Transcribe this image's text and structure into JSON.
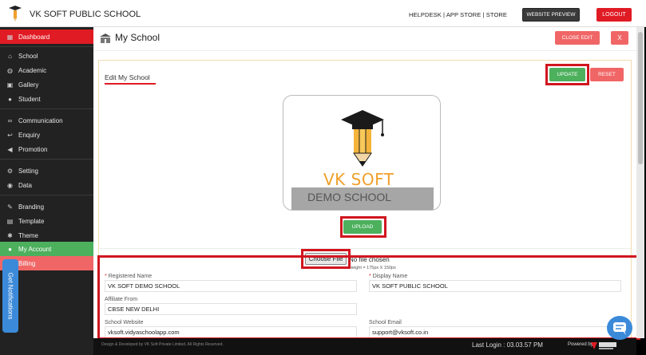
{
  "header": {
    "app_title": "VK SOFT PUBLIC SCHOOL",
    "links": "HELPDESK | APP STORE | STORE",
    "preview_label": "WEBSITE PREVIEW",
    "logout_label": "LOGOUT"
  },
  "sidebar": {
    "items": [
      {
        "label": "Dashboard",
        "icon": "dashboard-icon",
        "state": "active"
      },
      {
        "label": "School",
        "icon": "school-icon"
      },
      {
        "label": "Academic",
        "icon": "globe-icon"
      },
      {
        "label": "Gallery",
        "icon": "image-icon"
      },
      {
        "label": "Student",
        "icon": "user-icon"
      },
      {
        "label": "Communication",
        "icon": "link-icon"
      },
      {
        "label": "Enquiry",
        "icon": "reply-icon"
      },
      {
        "label": "Promotion",
        "icon": "megaphone-icon"
      },
      {
        "label": "Setting",
        "icon": "gear-icon"
      },
      {
        "label": "Data",
        "icon": "database-icon"
      },
      {
        "label": "Branding",
        "icon": "pencil-icon"
      },
      {
        "label": "Template",
        "icon": "template-icon"
      },
      {
        "label": "Theme",
        "icon": "bug-icon"
      },
      {
        "label": "My Account",
        "icon": "user-icon",
        "state": "success"
      },
      {
        "label": "Billing",
        "icon": "billing-icon",
        "state": "danger"
      }
    ],
    "notifications_tab": "Get Notifications"
  },
  "page": {
    "title": "My School",
    "close_edit_label": "CLOSE EDIT",
    "close_label": "X"
  },
  "card": {
    "title": "Edit My School",
    "update_label": "UPDATE",
    "reset_label": "RESET",
    "logo_text": "VK SOFT",
    "logo_caption": "DEMO SCHOOL",
    "upload_label": "UPLOAD",
    "choose_file_label": "Choose File",
    "file_status": "No file chosen",
    "size_hint": "Height = 175px X 150px"
  },
  "form": {
    "registered_name_label": "Registered Name",
    "registered_name_value": "VK SOFT DEMO SCHOOL",
    "display_name_label": "Display Name",
    "display_name_value": "VK SOFT PUBLIC SCHOOL",
    "affiliate_label": "Affiliate From",
    "affiliate_value": "CBSE NEW DELHI",
    "website_label": "School Website",
    "website_value": "vksoft.vidyaschoolapp.com",
    "email_label": "School Email",
    "email_value": "support@vksoft.co.in",
    "required_mark": "*"
  },
  "footer": {
    "left_text": "Design & Developed by VK Soft Private Limited. All Rights Reserved.",
    "last_login": "Last Login : 03.03.57 PM",
    "powered_by": "Powered by"
  },
  "colors": {
    "accent_red": "#e01b24",
    "success_green": "#4cb05d",
    "soft_red": "#f06666",
    "highlight_red": "#d0161f",
    "info_blue": "#3b8ad9"
  }
}
